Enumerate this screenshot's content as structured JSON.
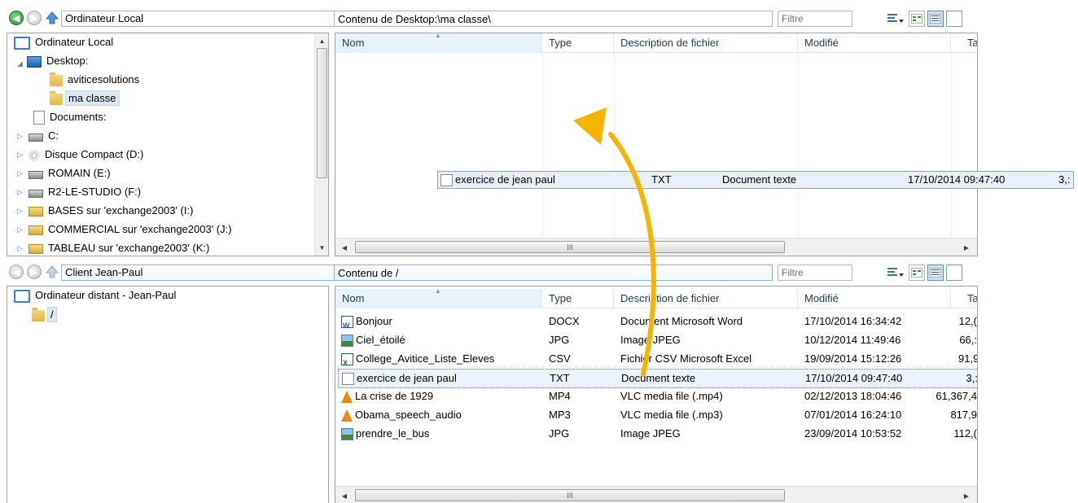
{
  "top": {
    "address": "Ordinateur Local",
    "content_label": "Contenu de Desktop:\\ma classe\\",
    "filter_placeholder": "Filtre",
    "tree": [
      {
        "label": "Ordinateur Local",
        "icon": "computer-icon"
      },
      {
        "label": "Desktop:",
        "icon": "desktop-icon"
      },
      {
        "label": "aviticesolutions",
        "icon": "folder-icon"
      },
      {
        "label": "ma classe",
        "icon": "folder-icon"
      },
      {
        "label": "Documents:",
        "icon": "document-icon"
      },
      {
        "label": "C:",
        "icon": "drive-icon"
      },
      {
        "label": "Disque Compact (D:)",
        "icon": "cd-icon"
      },
      {
        "label": "ROMAIN (E:)",
        "icon": "drive-icon"
      },
      {
        "label": "R2-LE-STUDIO (F:)",
        "icon": "drive-icon"
      },
      {
        "label": "BASES sur 'exchange2003' (I:)",
        "icon": "network-drive-icon"
      },
      {
        "label": "COMMERCIAL sur 'exchange2003' (J:)",
        "icon": "network-drive-icon"
      },
      {
        "label": "TABLEAU sur 'exchange2003' (K:)",
        "icon": "network-drive-icon"
      }
    ],
    "columns": [
      "Nom",
      "Type",
      "Description de fichier",
      "Modifié",
      "Ta"
    ],
    "hscroll_glyph": "III"
  },
  "drag": {
    "name": "exercice de jean paul",
    "type": "TXT",
    "desc": "Document texte",
    "modified": "17/10/2014 09:47:40",
    "size": "3,:"
  },
  "bottom": {
    "address": "Client Jean-Paul",
    "content_label": "Contenu de /",
    "filter_placeholder": "Filtre",
    "tree": [
      {
        "label": "Ordinateur distant - Jean-Paul",
        "icon": "computer-icon"
      },
      {
        "label": "/",
        "icon": "folder-icon"
      }
    ],
    "columns": [
      "Nom",
      "Type",
      "Description de fichier",
      "Modifié",
      "Ta"
    ],
    "files": [
      {
        "name": "Bonjour",
        "type": "DOCX",
        "desc": "Document Microsoft Word",
        "modified": "17/10/2014 16:34:42",
        "size": "12,(",
        "icon": "word-file-icon"
      },
      {
        "name": "Ciel_étoilé",
        "type": "JPG",
        "desc": "Image JPEG",
        "modified": "10/12/2014 11:49:46",
        "size": "66,:",
        "icon": "image-file-icon"
      },
      {
        "name": "College_Avitice_Liste_Eleves",
        "type": "CSV",
        "desc": "Fichier CSV Microsoft Excel",
        "modified": "19/09/2014 15:12:26",
        "size": "91,9",
        "icon": "excel-file-icon"
      },
      {
        "name": "exercice de jean paul",
        "type": "TXT",
        "desc": "Document texte",
        "modified": "17/10/2014 09:47:40",
        "size": "3,:",
        "icon": "text-file-icon"
      },
      {
        "name": "La crise de 1929",
        "type": "MP4",
        "desc": "VLC media file (.mp4)",
        "modified": "02/12/2013 18:04:46",
        "size": "61,367,4",
        "icon": "vlc-file-icon"
      },
      {
        "name": "Obama_speech_audio",
        "type": "MP3",
        "desc": "VLC media file (.mp3)",
        "modified": "07/01/2014 16:24:10",
        "size": "817,9",
        "icon": "vlc-file-icon"
      },
      {
        "name": "prendre_le_bus",
        "type": "JPG",
        "desc": "Image JPEG",
        "modified": "23/09/2014 10:53:52",
        "size": "112,(",
        "icon": "image-file-icon"
      }
    ],
    "hscroll_glyph": "III"
  },
  "colors": {
    "arrow": "#f5b400",
    "selection": "#eaf3fc",
    "accent": "#3c7fb1"
  }
}
